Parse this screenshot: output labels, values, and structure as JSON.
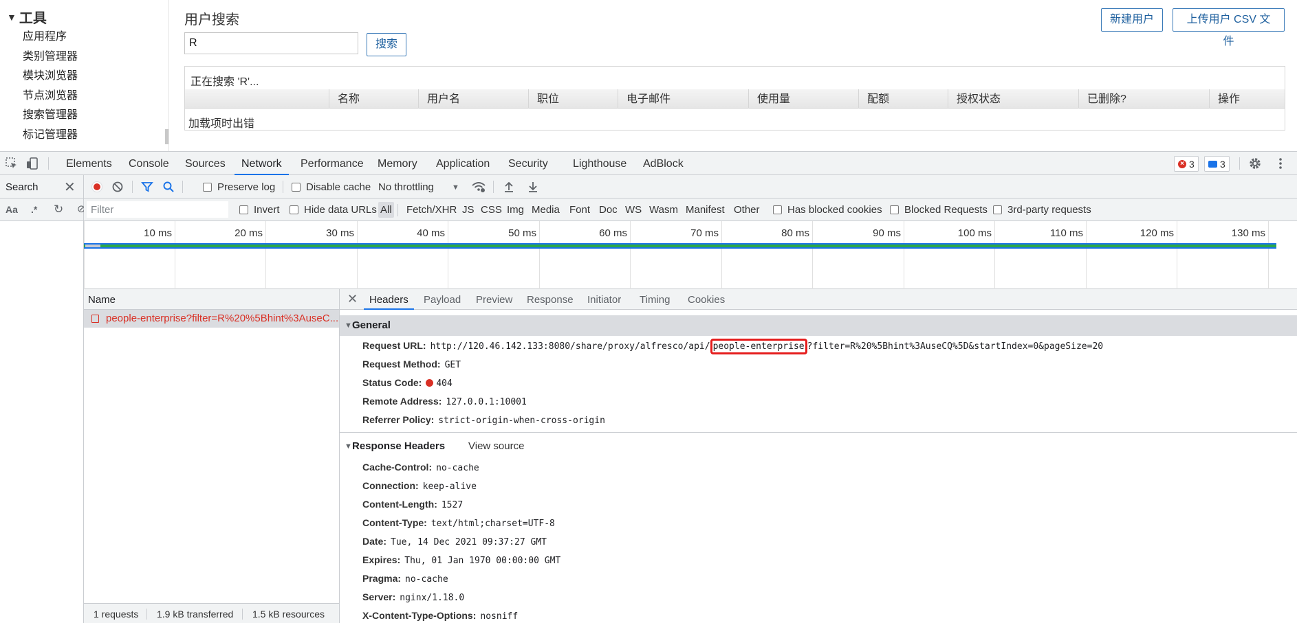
{
  "app": {
    "sidebar": {
      "section": "工具",
      "items": [
        "应用程序",
        "类别管理器",
        "模块浏览器",
        "节点浏览器",
        "搜索管理器",
        "标记管理器"
      ]
    },
    "title": "用户搜索",
    "search_value": "R",
    "search_label": "搜索",
    "new_user_label": "新建用户",
    "upload_csv_label": "上传用户 CSV 文件",
    "results": {
      "status": "正在搜索 'R'...",
      "columns": [
        "",
        "名称",
        "用户名",
        "职位",
        "电子邮件",
        "使用量",
        "配额",
        "授权状态",
        "已删除?",
        "操作"
      ],
      "error": "加载项时出错"
    }
  },
  "devtools": {
    "tabs": [
      "Elements",
      "Console",
      "Sources",
      "Network",
      "Performance",
      "Memory",
      "Application",
      "Security",
      "Lighthouse",
      "AdBlock"
    ],
    "active_tab": "Network",
    "error_count": "3",
    "message_count": "3",
    "search_pane": {
      "label": "Search",
      "opt_case": "Aa",
      "opt_regex": ".*"
    },
    "toolbar": {
      "preserve_log": "Preserve log",
      "disable_cache": "Disable cache",
      "throttling": "No throttling"
    },
    "filter": {
      "placeholder": "Filter",
      "invert": "Invert",
      "hide_data_urls": "Hide data URLs",
      "types": [
        "All",
        "Fetch/XHR",
        "JS",
        "CSS",
        "Img",
        "Media",
        "Font",
        "Doc",
        "WS",
        "Wasm",
        "Manifest",
        "Other"
      ],
      "has_blocked_cookies": "Has blocked cookies",
      "blocked_requests": "Blocked Requests",
      "third_party": "3rd-party requests"
    },
    "overview_ticks": [
      "10 ms",
      "20 ms",
      "30 ms",
      "40 ms",
      "50 ms",
      "60 ms",
      "70 ms",
      "80 ms",
      "90 ms",
      "100 ms",
      "110 ms",
      "120 ms",
      "130 ms"
    ],
    "request_list": {
      "header": "Name",
      "request": "people-enterprise?filter=R%20%5Bhint%3AuseC...",
      "footer": {
        "requests": "1 requests",
        "transferred": "1.9 kB transferred",
        "resources": "1.5 kB resources"
      }
    },
    "details": {
      "tabs": [
        "Headers",
        "Payload",
        "Preview",
        "Response",
        "Initiator",
        "Timing",
        "Cookies"
      ],
      "active_tab": "Headers",
      "general": {
        "title": "General",
        "request_url_key": "Request URL:",
        "request_url_prefix": "http://120.46.142.133:8080/share/proxy/alfresco/api/",
        "request_url_highlight": "people-enterprise",
        "request_url_suffix": "?filter=R%20%5Bhint%3AuseCQ%5D&startIndex=0&pageSize=20",
        "rows": [
          {
            "k": "Request Method:",
            "v": "GET"
          },
          {
            "k": "Status Code:",
            "v": "404"
          },
          {
            "k": "Remote Address:",
            "v": "127.0.0.1:10001"
          },
          {
            "k": "Referrer Policy:",
            "v": "strict-origin-when-cross-origin"
          }
        ]
      },
      "response_headers": {
        "title": "Response Headers",
        "view_source": "View source",
        "rows": [
          {
            "k": "Cache-Control:",
            "v": "no-cache"
          },
          {
            "k": "Connection:",
            "v": "keep-alive"
          },
          {
            "k": "Content-Length:",
            "v": "1527"
          },
          {
            "k": "Content-Type:",
            "v": "text/html;charset=UTF-8"
          },
          {
            "k": "Date:",
            "v": "Tue, 14 Dec 2021 09:37:27 GMT"
          },
          {
            "k": "Expires:",
            "v": "Thu, 01 Jan 1970 00:00:00 GMT"
          },
          {
            "k": "Pragma:",
            "v": "no-cache"
          },
          {
            "k": "Server:",
            "v": "nginx/1.18.0"
          },
          {
            "k": "X-Content-Type-Options:",
            "v": "nosniff"
          }
        ]
      }
    },
    "colors": {
      "accent": "#1a73e8",
      "error": "#d93025",
      "record": "#d93025"
    }
  }
}
